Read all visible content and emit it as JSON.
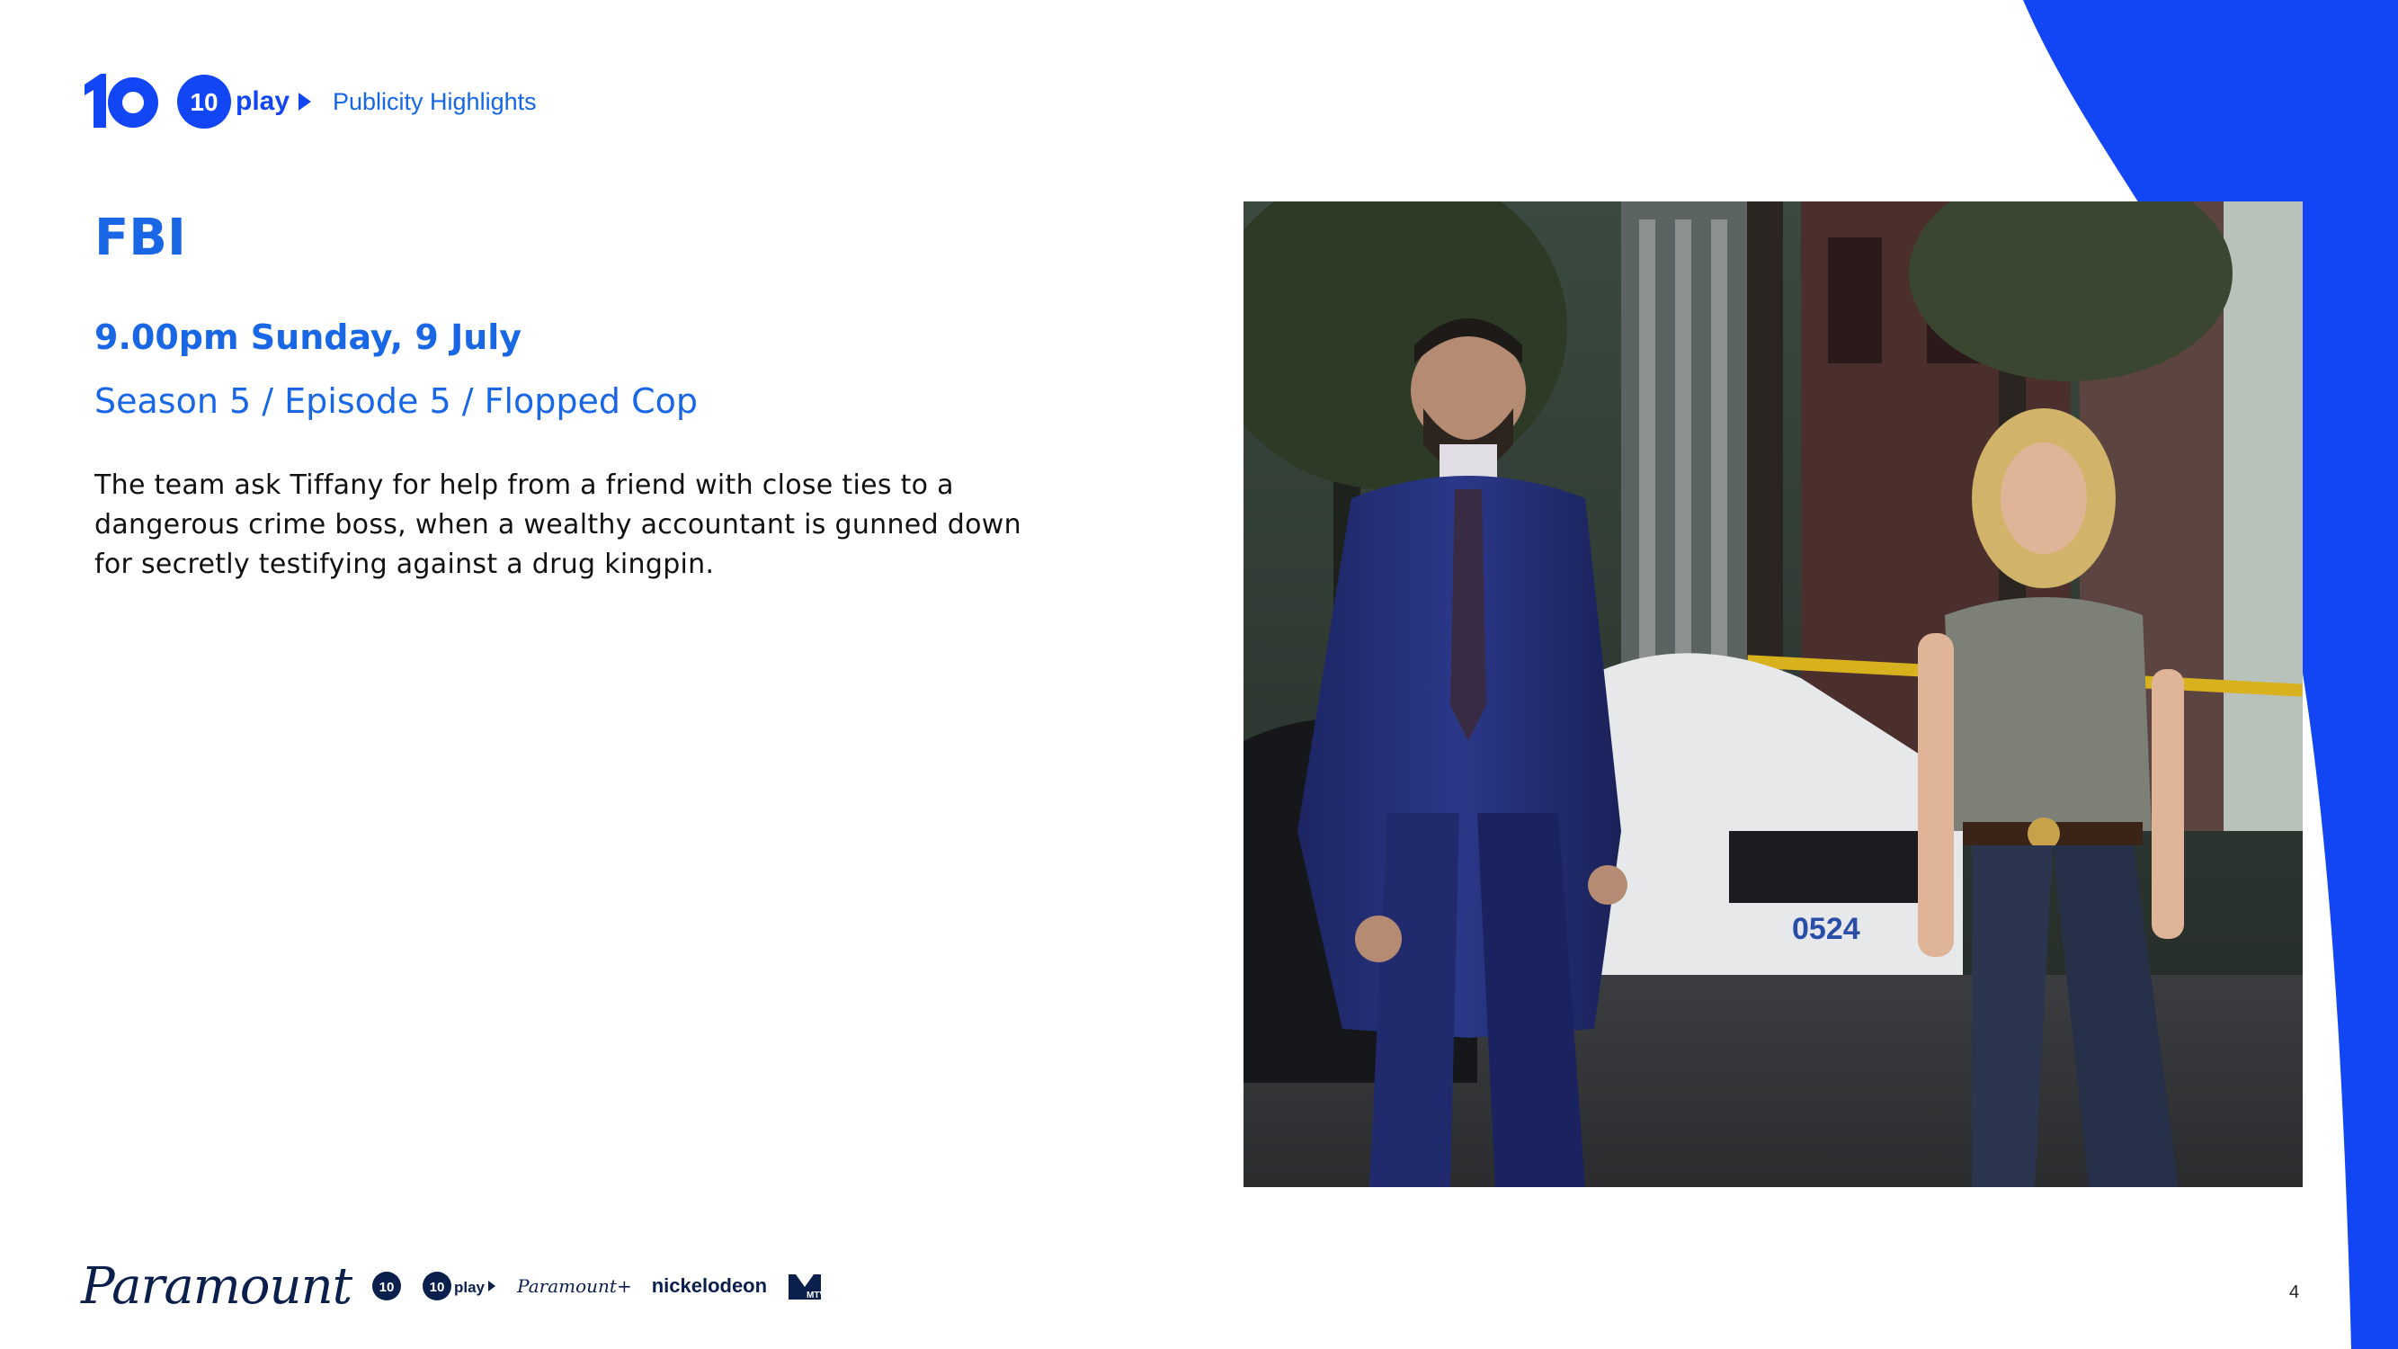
{
  "brand": {
    "primary_blue": "#1a67e6",
    "accent_blue": "#1246f5",
    "ten_logo_text": "10",
    "tenplay_logo_text": "play",
    "section_label": "Publicity Highlights"
  },
  "slide": {
    "title": "FBI",
    "airtime": "9.00pm Sunday, 9 July",
    "episode": "Season 5 / Episode 5 / Flopped Cop",
    "synopsis": "The team ask Tiffany for help from a friend with close ties to a dangerous crime boss, when a wealthy accountant is gunned down for secretly testifying against a drug kingpin."
  },
  "photo": {
    "police_plate": "0524"
  },
  "footer": {
    "paramount": "Paramount",
    "ten": "10",
    "tenplay": "play",
    "paramount_plus": "Paramount+",
    "nickelodeon": "nickelodeon",
    "mtv": "MTV",
    "page_number": "4"
  }
}
